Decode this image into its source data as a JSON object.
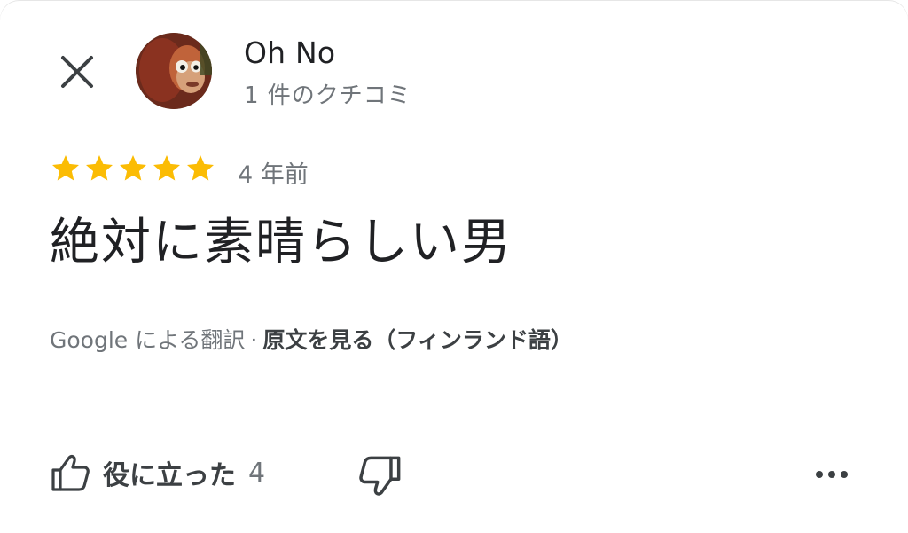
{
  "author": {
    "name": "Oh No",
    "review_count": "1 件のクチコミ",
    "avatar_icon": "monkey-puppet-avatar"
  },
  "review": {
    "rating": 5,
    "rating_max": 5,
    "star_color": "#fbbc04",
    "date": "4 年前",
    "text": "絶対に素晴らしい男"
  },
  "translation": {
    "source": "Google による翻訳",
    "separator": "·",
    "original_link": "原文を見る（フィンランド語）"
  },
  "actions": {
    "helpful_label": "役に立った",
    "helpful_count": "4",
    "like_icon": "thumbs-up-icon",
    "dislike_icon": "thumbs-down-icon",
    "more_icon": "more-horizontal-icon",
    "close_icon": "close-icon"
  }
}
